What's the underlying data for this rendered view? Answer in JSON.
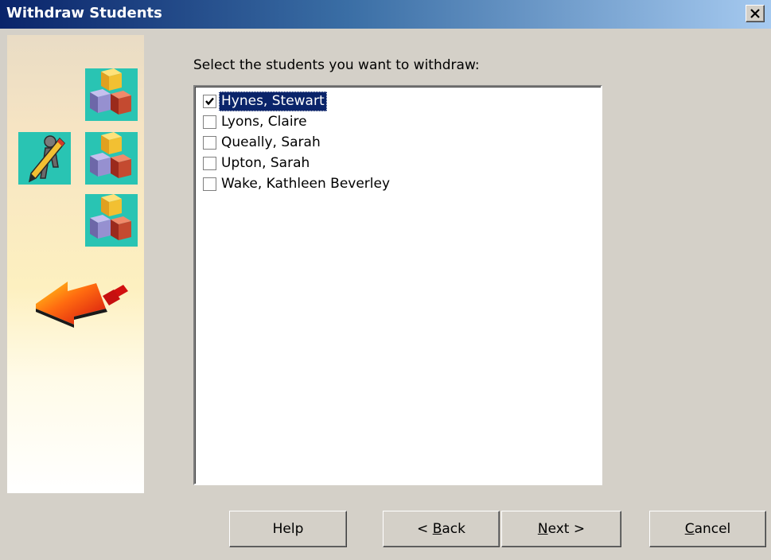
{
  "window": {
    "title": "Withdraw Students",
    "close_icon": "close-icon"
  },
  "content": {
    "prompt": "Select the students you want to withdraw:",
    "students": [
      {
        "name": "Hynes, Stewart",
        "checked": true,
        "selected": true
      },
      {
        "name": "Lyons, Claire",
        "checked": false,
        "selected": false
      },
      {
        "name": "Queally, Sarah",
        "checked": false,
        "selected": false
      },
      {
        "name": "Upton, Sarah",
        "checked": false,
        "selected": false
      },
      {
        "name": "Wake, Kathleen Beverley",
        "checked": false,
        "selected": false
      }
    ]
  },
  "buttons": {
    "help": "Help",
    "back_prefix": "< ",
    "back_mnemonic": "B",
    "back_rest": "ack",
    "next_mnemonic": "N",
    "next_rest": "ext >",
    "cancel_mnemonic": "C",
    "cancel_rest": "ancel"
  },
  "icons": [
    "cubes-icon",
    "cubes-icon",
    "cubes-icon",
    "student-pencil-icon",
    "arrow-left-icon"
  ],
  "colors": {
    "title_gradient_start": "#0a246a",
    "title_gradient_end": "#a6caf0",
    "selection": "#0a246a",
    "dialog_face": "#d4d0c8"
  }
}
